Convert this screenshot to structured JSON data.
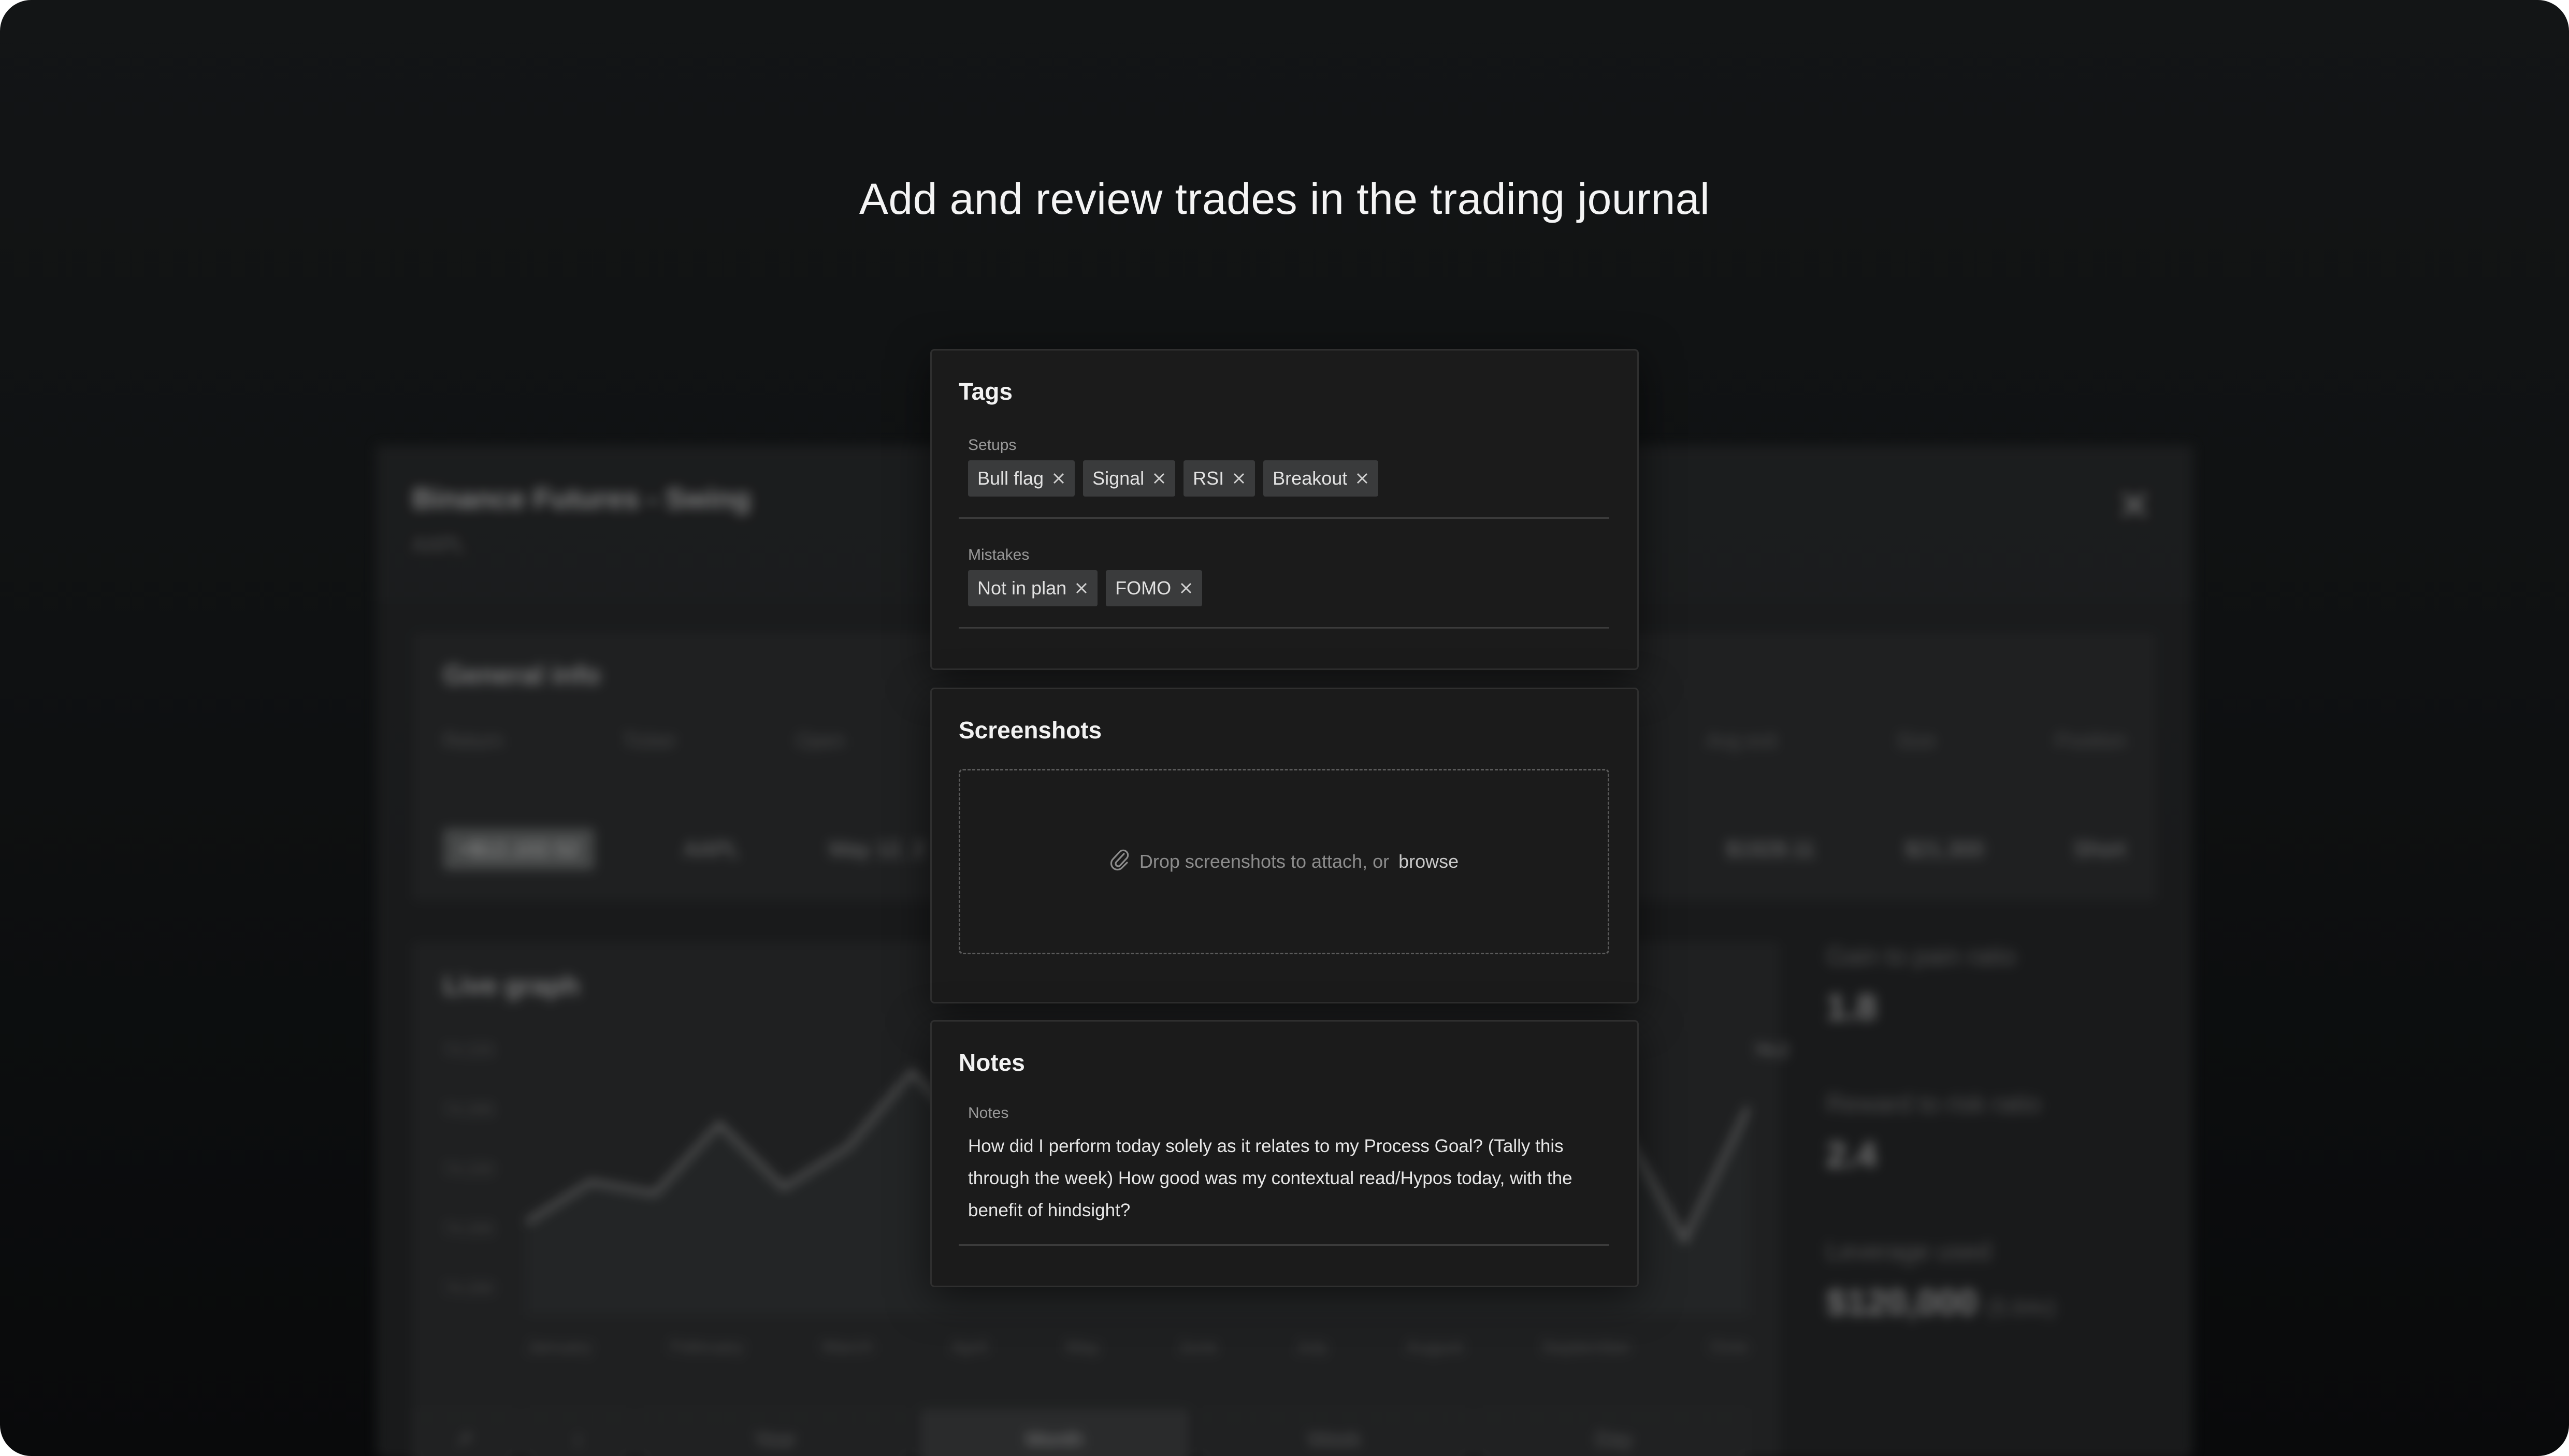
{
  "headline": "Add and review trades in the trading journal",
  "background_window": {
    "title": "Binance Futures - Swing",
    "subtitle": "AAPL",
    "close_glyph": "✕",
    "general_info": {
      "title": "General info",
      "columns": [
        "Return",
        "Ticker",
        "Open",
        "Avg exit",
        "Size",
        "Position"
      ],
      "values": [
        "+$12,102.52",
        "AAPL",
        "May 12, 2",
        "$1928.11",
        "$21,300",
        "Short"
      ]
    },
    "live_graph": {
      "title": "Live graph",
      "y_labels": [
        "74.225",
        "74.205",
        "74.220",
        "74.205",
        "74.200"
      ],
      "x_labels": [
        "January",
        "February",
        "March",
        "April",
        "May",
        "June",
        "July",
        "August",
        "September",
        "Octo"
      ],
      "peak_label": "74.2",
      "points": [
        0.32,
        0.46,
        0.42,
        0.66,
        0.44,
        0.58,
        0.84,
        0.6,
        0.7,
        0.36,
        0.52,
        0.4,
        0.3,
        0.44,
        0.22,
        0.48,
        0.38,
        0.66,
        0.26,
        0.72
      ]
    },
    "stats": [
      {
        "label": "Gain to pain ratio",
        "value": "1.8",
        "extra": ""
      },
      {
        "label": "Reward to risk ratio",
        "value": "2.4",
        "extra": ""
      },
      {
        "label": "Leverage used",
        "value": "$120,000",
        "extra": "(5.64x)"
      }
    ],
    "timeframes": [
      "Year",
      "Month",
      "Week",
      "Day"
    ],
    "active_timeframe": "Month"
  },
  "tags_panel": {
    "title": "Tags",
    "setups_label": "Setups",
    "setups": [
      "Bull flag",
      "Signal",
      "RSI",
      "Breakout"
    ],
    "mistakes_label": "Mistakes",
    "mistakes": [
      "Not in plan",
      "FOMO"
    ]
  },
  "screenshots_panel": {
    "title": "Screenshots",
    "drop_text": "Drop screenshots to attach, or",
    "browse_text": "browse",
    "icon": "paperclip-icon"
  },
  "notes_panel": {
    "title": "Notes",
    "field_label": "Notes",
    "text": "How did I perform today solely as it relates to my Process Goal? (Tally this through the week) How good was my contextual read/Hypos today, with the benefit of hindsight?"
  },
  "colors": {
    "background": "#0f1112",
    "panel": "#1b1b1b",
    "tag": "#3a3b3c",
    "text": "#f2f2f2"
  }
}
